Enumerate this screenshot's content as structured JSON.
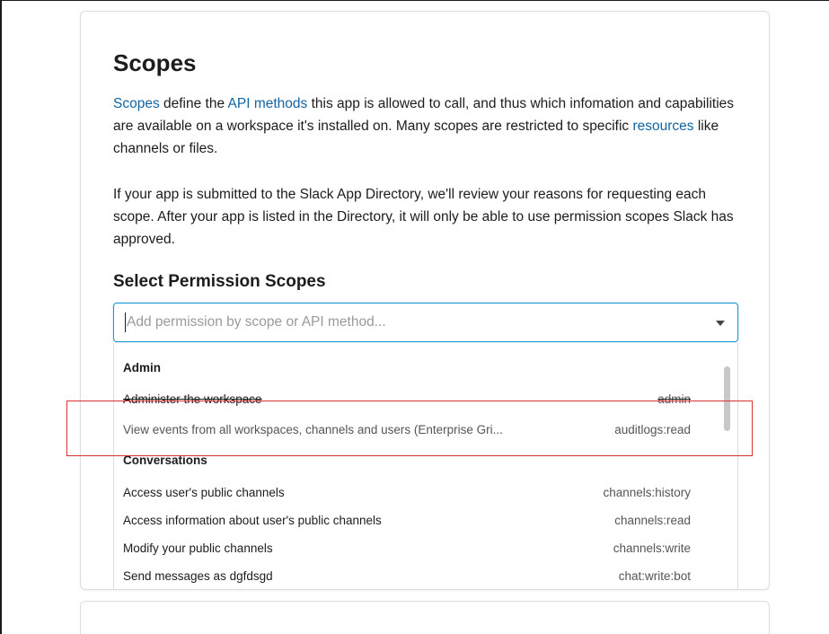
{
  "section": {
    "title": "Scopes",
    "intro": {
      "link_scopes": "Scopes",
      "text_1": " define the ",
      "link_api_methods": "API methods",
      "text_2": " this app is allowed to call, and thus which infomation and capabilities are available on a workspace it's installed on. Many scopes are restricted to specific ",
      "link_resources": "resources",
      "text_3": " like channels or files."
    },
    "review_note": "If your app is submitted to the Slack App Directory, we'll review your reasons for requesting each scope. After your app is listed in the Directory, it will only be able to use permission scopes Slack has approved."
  },
  "permission_scopes": {
    "heading": "Select Permission Scopes",
    "search": {
      "placeholder": "Add permission by scope or API method...",
      "value": ""
    },
    "groups": [
      {
        "name": "Admin",
        "items": [
          {
            "description": "Administer the workspace",
            "scope": "admin"
          },
          {
            "description": "View events from all workspaces, channels and users (Enterprise Gri...",
            "scope": "auditlogs:read"
          }
        ]
      },
      {
        "name": "Conversations",
        "items": [
          {
            "description": "Access user's public channels",
            "scope": "channels:history"
          },
          {
            "description": "Access information about user's public channels",
            "scope": "channels:read"
          },
          {
            "description": "Modify your public channels",
            "scope": "channels:write"
          },
          {
            "description": "Send messages as dgfdsgd",
            "scope": "chat:write:bot"
          }
        ]
      }
    ]
  },
  "colors": {
    "link": "#1264a3",
    "focus_border": "#1d9bd1",
    "annotation": "#d9342b"
  }
}
